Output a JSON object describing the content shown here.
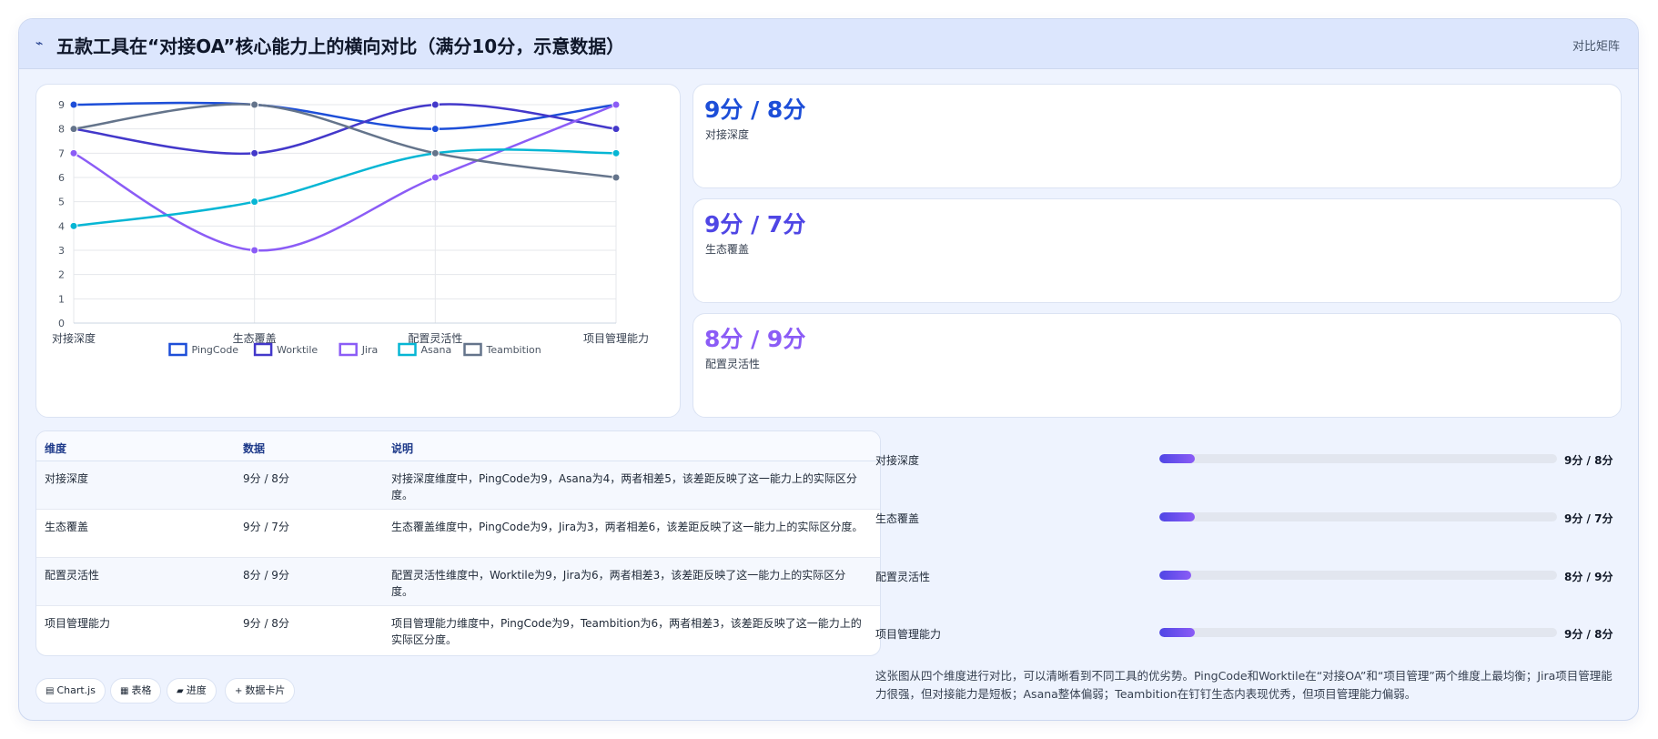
{
  "header": {
    "icon": "pulse-icon",
    "title": "五款工具在“对接OA”核心能力上的横向对比（满分10分，示意数据）",
    "link_label": "对比矩阵"
  },
  "chart_data": {
    "type": "line",
    "categories": [
      "对接深度",
      "生态覆盖",
      "配置灵活性",
      "项目管理能力"
    ],
    "ylim": [
      0,
      9
    ],
    "yticks": [
      "0",
      "1",
      "2",
      "3",
      "4",
      "5",
      "6",
      "7",
      "8",
      "9"
    ],
    "legend_position": "bottom",
    "grid": true,
    "series": [
      {
        "name": "PingCode",
        "color": "#1d4ed8",
        "values": [
          9,
          9,
          8,
          9
        ]
      },
      {
        "name": "Worktile",
        "color": "#4338ca",
        "values": [
          8,
          7,
          9,
          8
        ]
      },
      {
        "name": "Jira",
        "color": "#8b5cf6",
        "values": [
          7,
          3,
          6,
          9
        ]
      },
      {
        "name": "Asana",
        "color": "#06b6d4",
        "values": [
          4,
          5,
          7,
          7
        ]
      },
      {
        "name": "Teambition",
        "color": "#64748b",
        "values": [
          8,
          9,
          7,
          6
        ]
      }
    ]
  },
  "stats": [
    {
      "value": "9分 / 8分",
      "label": "对接深度",
      "color": "#1d4ed8"
    },
    {
      "value": "9分 / 7分",
      "label": "生态覆盖",
      "color": "#4f46e5"
    },
    {
      "value": "8分 / 9分",
      "label": "配置灵活性",
      "color": "#8b5cf6"
    }
  ],
  "table": {
    "headers": [
      "维度",
      "数据",
      "说明"
    ],
    "rows": [
      {
        "dimension": "对接深度",
        "data": "9分 / 8分",
        "desc": "对接深度维度中，PingCode为9，Asana为4，两者相差5，该差距反映了这一能力上的实际区分度。"
      },
      {
        "dimension": "生态覆盖",
        "data": "9分 / 7分",
        "desc": "生态覆盖维度中，PingCode为9，Jira为3，两者相差6，该差距反映了这一能力上的实际区分度。"
      },
      {
        "dimension": "配置灵活性",
        "data": "8分 / 9分",
        "desc": "配置灵活性维度中，Worktile为9，Jira为6，两者相差3，该差距反映了这一能力上的实际区分度。"
      },
      {
        "dimension": "项目管理能力",
        "data": "9分 / 8分",
        "desc": "项目管理能力维度中，PingCode为9，Teambition为6，两者相差3，该差距反映了这一能力上的实际区分度。"
      }
    ]
  },
  "progress": [
    {
      "label": "对接深度",
      "value": "9分 / 8分",
      "fill_fraction": 0.09
    },
    {
      "label": "生态覆盖",
      "value": "9分 / 7分",
      "fill_fraction": 0.09
    },
    {
      "label": "配置灵活性",
      "value": "8分 / 9分",
      "fill_fraction": 0.08
    },
    {
      "label": "项目管理能力",
      "value": "9分 / 8分",
      "fill_fraction": 0.09
    }
  ],
  "summary": "这张图从四个维度进行对比，可以清晰看到不同工具的优劣势。PingCode和Worktile在“对接OA”和“项目管理”两个维度上最均衡；Jira项目管理能力很强，但对接能力是短板；Asana整体偏弱；Teambition在钉钉生态内表现优秀，但项目管理能力偏弱。",
  "tags": [
    {
      "icon": "chart-icon",
      "glyph": "▤",
      "label": "Chart.js"
    },
    {
      "icon": "table-icon",
      "glyph": "▦",
      "label": "表格"
    },
    {
      "icon": "progress-icon",
      "glyph": "▰",
      "label": "进度"
    },
    {
      "icon": "plus-icon",
      "glyph": "+",
      "label": "数据卡片"
    }
  ]
}
